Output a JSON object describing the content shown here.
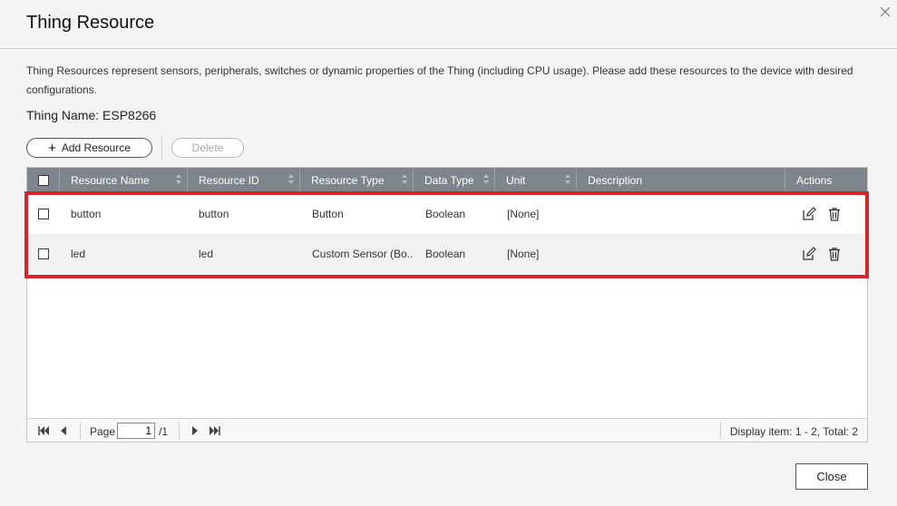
{
  "dialog": {
    "title": "Thing Resource",
    "description": "Thing Resources represent sensors, peripherals, switches or dynamic properties of the Thing (including CPU usage). Please add these resources to the device with desired configurations.",
    "thing_name_label": "Thing Name: ESP8266",
    "close_icon": "close-icon"
  },
  "toolbar": {
    "add_label": "Add Resource",
    "delete_label": "Delete"
  },
  "table": {
    "columns": [
      "Resource Name",
      "Resource ID",
      "Resource Type",
      "Data Type",
      "Unit",
      "Description",
      "Actions"
    ],
    "rows": [
      {
        "name": "button",
        "id": "button",
        "type": "Button",
        "data_type": "Boolean",
        "unit": "[None]",
        "description": ""
      },
      {
        "name": "led",
        "id": "led",
        "type": "Custom Sensor (Bo...",
        "data_type": "Boolean",
        "unit": "[None]",
        "description": ""
      }
    ]
  },
  "pager": {
    "page_label": "Page",
    "page_value": "1",
    "total_pages": "/1",
    "display": "Display item: 1 - 2, Total: 2"
  },
  "footer": {
    "close_label": "Close"
  },
  "colors": {
    "header_bg": "#7f858d",
    "highlight": "#d9232d"
  }
}
